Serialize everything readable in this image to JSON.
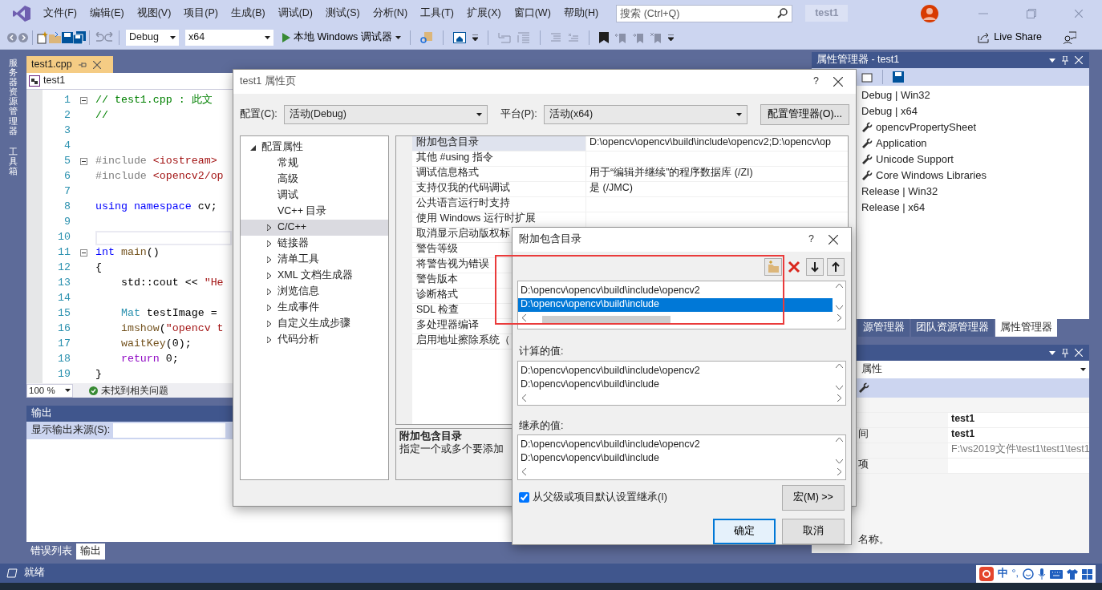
{
  "menu": [
    {
      "label": "文件(F)"
    },
    {
      "label": "编辑(E)"
    },
    {
      "label": "视图(V)"
    },
    {
      "label": "项目(P)"
    },
    {
      "label": "生成(B)"
    },
    {
      "label": "调试(D)"
    },
    {
      "label": "测试(S)"
    },
    {
      "label": "分析(N)"
    },
    {
      "label": "工具(T)"
    },
    {
      "label": "扩展(X)"
    },
    {
      "label": "窗口(W)"
    },
    {
      "label": "帮助(H)"
    }
  ],
  "search": {
    "placeholder": "搜索 (Ctrl+Q)"
  },
  "solution_name": "test1",
  "toolbar": {
    "configuration": "Debug",
    "platform": "x64",
    "run_label": "本地 Windows 调试器",
    "live_share": "Live Share"
  },
  "side_tabs": [
    "服务器资源管理器",
    "工具箱"
  ],
  "editor": {
    "tab": {
      "label": "test1.cpp",
      "selected": true
    },
    "scope": "test1",
    "zoom": "100 %",
    "status": "未找到相关问题",
    "lines": [
      {
        "number": "1",
        "fold": true,
        "current": false,
        "tokens": [
          {
            "kind": "comment",
            "text": "// test1.cpp : 此文"
          }
        ]
      },
      {
        "number": "2",
        "fold": false,
        "current": false,
        "tokens": [
          {
            "kind": "comment",
            "text": "//"
          }
        ]
      },
      {
        "number": "3",
        "fold": false,
        "current": false
      },
      {
        "number": "4",
        "fold": false,
        "current": false
      },
      {
        "number": "5",
        "fold": true,
        "current": false,
        "tokens": [
          {
            "kind": "preproc",
            "text": "#include "
          },
          {
            "kind": "string",
            "text": "<iostream>"
          }
        ]
      },
      {
        "number": "6",
        "fold": false,
        "current": false,
        "tokens": [
          {
            "kind": "preproc",
            "text": "#include "
          },
          {
            "kind": "string",
            "text": "<opencv2/op"
          }
        ]
      },
      {
        "number": "7",
        "fold": false,
        "current": false
      },
      {
        "number": "8",
        "fold": false,
        "current": false,
        "tokens": [
          {
            "kind": "keyword",
            "text": "using namespace"
          },
          {
            "kind": "plain",
            "text": " cv;"
          }
        ]
      },
      {
        "number": "9",
        "fold": false,
        "current": false
      },
      {
        "number": "10",
        "fold": false,
        "current": true
      },
      {
        "number": "11",
        "fold": true,
        "current": false,
        "tokens": [
          {
            "kind": "keyword",
            "text": "int"
          },
          {
            "kind": "function",
            "text": " main"
          },
          {
            "kind": "plain",
            "text": "()"
          }
        ]
      },
      {
        "number": "12",
        "fold": false,
        "current": false,
        "tokens": [
          {
            "kind": "plain",
            "text": "{"
          }
        ]
      },
      {
        "number": "13",
        "fold": false,
        "current": false,
        "tokens": [
          {
            "kind": "plain",
            "text": "    std::cout << "
          },
          {
            "kind": "string",
            "text": "\"He"
          }
        ]
      },
      {
        "number": "14",
        "fold": false,
        "current": false
      },
      {
        "number": "15",
        "fold": false,
        "current": false,
        "tokens": [
          {
            "kind": "type",
            "text": "    Mat"
          },
          {
            "kind": "plain",
            "text": " testImage ="
          }
        ]
      },
      {
        "number": "16",
        "fold": false,
        "current": false,
        "tokens": [
          {
            "kind": "function",
            "text": "    imshow"
          },
          {
            "kind": "plain",
            "text": "("
          },
          {
            "kind": "string",
            "text": "\"opencv t"
          }
        ]
      },
      {
        "number": "17",
        "fold": false,
        "current": false,
        "tokens": [
          {
            "kind": "function",
            "text": "    waitKey"
          },
          {
            "kind": "plain",
            "text": "(0);"
          }
        ]
      },
      {
        "number": "18",
        "fold": false,
        "current": false,
        "tokens": [
          {
            "kind": "control",
            "text": "    return"
          },
          {
            "kind": "plain",
            "text": " 0;"
          }
        ]
      },
      {
        "number": "19",
        "fold": false,
        "current": false,
        "tokens": [
          {
            "kind": "plain",
            "text": "}"
          }
        ]
      }
    ]
  },
  "output": {
    "title": "输出",
    "source_label": "显示输出来源(S):"
  },
  "bottom_tabs": [
    {
      "label": "错误列表",
      "selected": false
    },
    {
      "label": "输出",
      "selected": true
    }
  ],
  "status_bar": "就绪",
  "property_manager": {
    "title": "属性管理器 - test1",
    "tree": [
      {
        "label": "Debug | Win32",
        "kind": "config"
      },
      {
        "label": "Debug | x64",
        "kind": "config",
        "children": [
          {
            "label": "opencvPropertySheet",
            "kind": "sheet"
          },
          {
            "label": "Application",
            "kind": "sheet"
          },
          {
            "label": "Unicode Support",
            "kind": "sheet"
          },
          {
            "label": "Core Windows Libraries",
            "kind": "sheet"
          }
        ]
      },
      {
        "label": "Release | Win32",
        "kind": "config"
      },
      {
        "label": "Release | x64",
        "kind": "config"
      }
    ],
    "tabs": [
      {
        "label": "源管理器",
        "selected": false
      },
      {
        "label": "团队资源管理器",
        "selected": false
      },
      {
        "label": "属性管理器",
        "selected": true
      }
    ]
  },
  "properties_panel": {
    "object": "属性",
    "rows": [
      {
        "value": "test1"
      },
      {
        "name": "间",
        "value": "test1"
      },
      {
        "value": "F:\\vs2019文件\\test1\\test1\\test1"
      },
      {
        "name": "项"
      }
    ],
    "description": "名称。"
  },
  "property_pages": {
    "title": "test1 属性页",
    "help": "?",
    "config_label": "配置(C):",
    "config_value": "活动(Debug)",
    "platform_label": "平台(P):",
    "platform_value": "活动(x64)",
    "manager_button": "配置管理器(O)...",
    "tree": [
      {
        "label": "配置属性",
        "kind": "group",
        "expanded": true,
        "selected": false,
        "children": [
          {
            "label": "常规",
            "kind": "leaf",
            "selected": false
          },
          {
            "label": "高级",
            "kind": "leaf",
            "selected": false
          },
          {
            "label": "调试",
            "kind": "leaf",
            "selected": false
          },
          {
            "label": "VC++ 目录",
            "kind": "leaf",
            "selected": false
          },
          {
            "label": "C/C++",
            "kind": "group",
            "expanded": false,
            "selected": true
          },
          {
            "label": "链接器",
            "kind": "group",
            "expanded": false,
            "selected": false
          },
          {
            "label": "清单工具",
            "kind": "group",
            "expanded": false,
            "selected": false
          },
          {
            "label": "XML 文档生成器",
            "kind": "group",
            "expanded": false,
            "selected": false
          },
          {
            "label": "浏览信息",
            "kind": "group",
            "expanded": false,
            "selected": false
          },
          {
            "label": "生成事件",
            "kind": "group",
            "expanded": false,
            "selected": false
          },
          {
            "label": "自定义生成步骤",
            "kind": "group",
            "expanded": false,
            "selected": false
          },
          {
            "label": "代码分析",
            "kind": "group",
            "expanded": false,
            "selected": false
          }
        ]
      }
    ],
    "grid": [
      {
        "name": "附加包含目录",
        "value": "D:\\opencv\\opencv\\build\\include\\opencv2;D:\\opencv\\op",
        "selected": true
      },
      {
        "name": "其他 #using 指令",
        "selected": false
      },
      {
        "name": "调试信息格式",
        "value": "用于“编辑并继续”的程序数据库 (/ZI)",
        "selected": false
      },
      {
        "name": "支持仅我的代码调试",
        "value": "是 (/JMC)",
        "selected": false
      },
      {
        "name": "公共语言运行时支持",
        "selected": false
      },
      {
        "name": "使用 Windows 运行时扩展",
        "selected": false
      },
      {
        "name": "取消显示启动版权标",
        "selected": false
      },
      {
        "name": "警告等级",
        "selected": false
      },
      {
        "name": "将警告视为错误",
        "selected": false
      },
      {
        "name": "警告版本",
        "selected": false
      },
      {
        "name": "诊断格式",
        "selected": false
      },
      {
        "name": "SDL 检查",
        "selected": false
      },
      {
        "name": "多处理器编译",
        "selected": false
      },
      {
        "name": "启用地址擦除系统（",
        "selected": false
      }
    ],
    "description": {
      "title": "附加包含目录",
      "text": "指定一个或多个要添加"
    }
  },
  "include_dialog": {
    "title": "附加包含目录",
    "help": "?",
    "entries": [
      {
        "path": "D:\\opencv\\opencv\\build\\include\\opencv2",
        "selected": false
      },
      {
        "path": "D:\\opencv\\opencv\\build\\include",
        "selected": true
      }
    ],
    "computed_label": "计算的值:",
    "computed": [
      "D:\\opencv\\opencv\\build\\include\\opencv2",
      "D:\\opencv\\opencv\\build\\include"
    ],
    "inherited_label": "继承的值:",
    "inherited": [
      "D:\\opencv\\opencv\\build\\include\\opencv2",
      "D:\\opencv\\opencv\\build\\include"
    ],
    "inherit": {
      "label": "从父级或项目默认设置继承(I)",
      "checked": true
    },
    "macros_button": "宏(M) >>",
    "ok_button": "确定",
    "cancel_button": "取消"
  },
  "ime": {
    "mode": "中",
    "punct": "°,"
  }
}
